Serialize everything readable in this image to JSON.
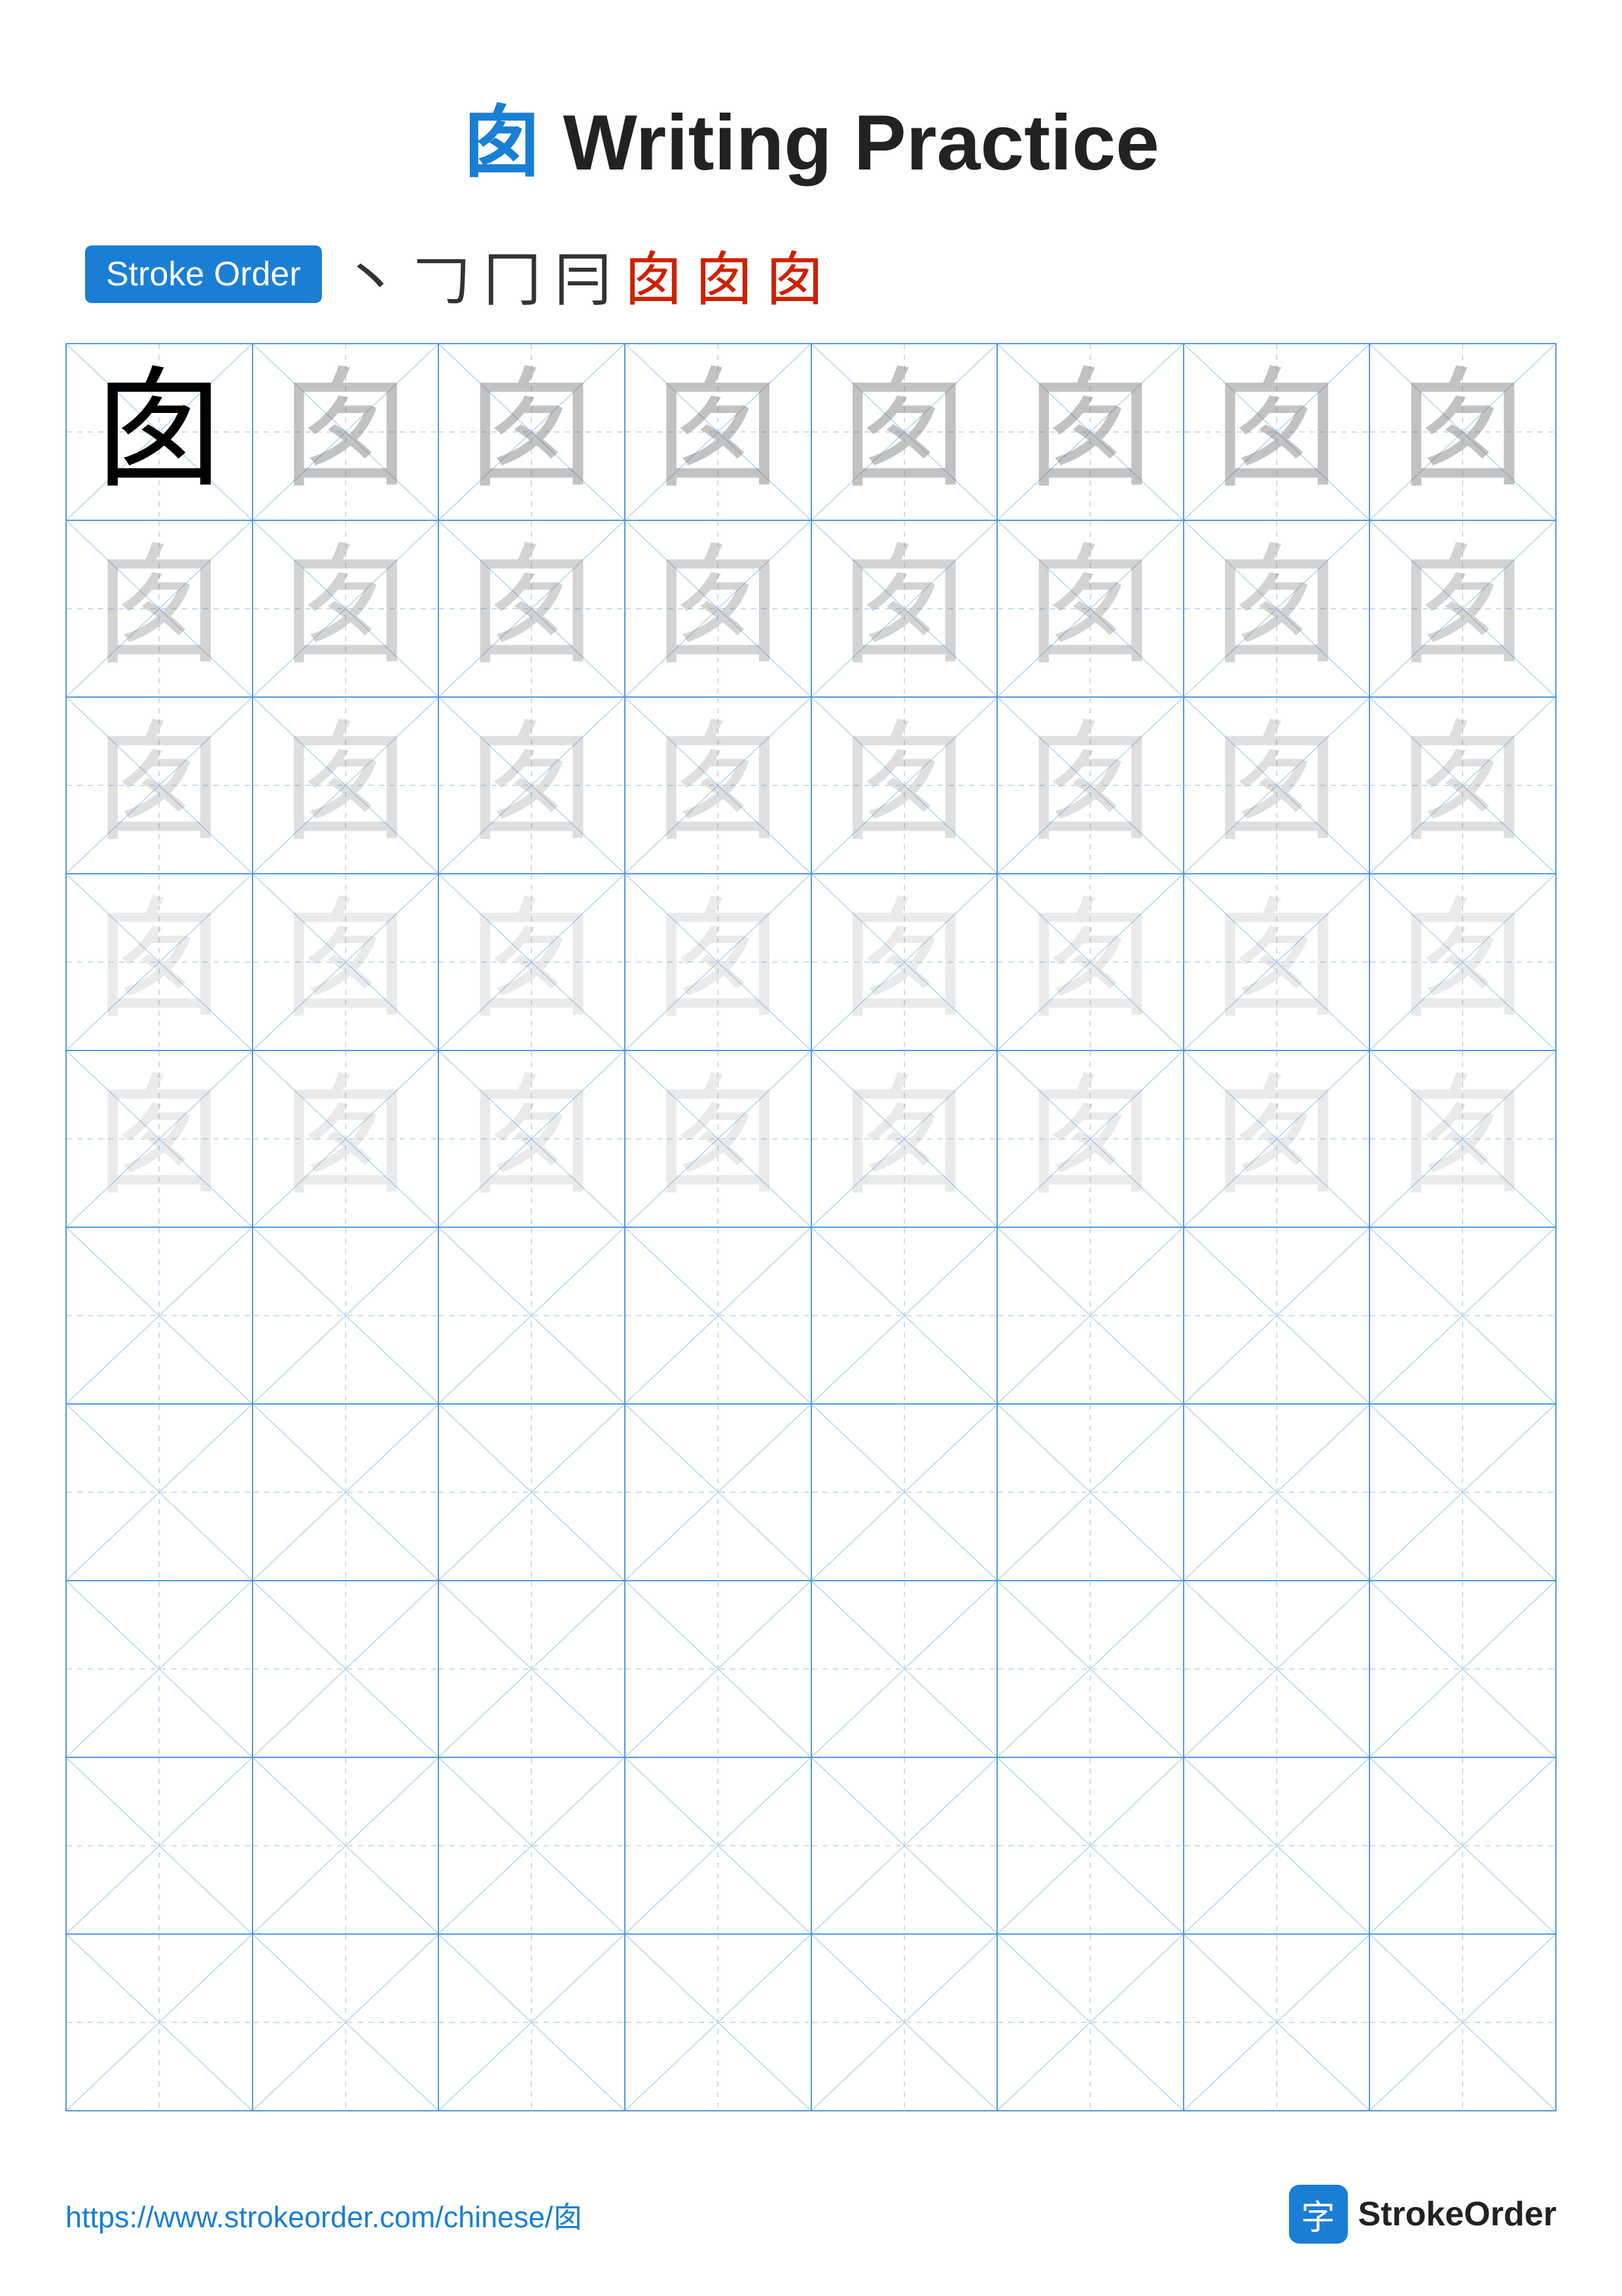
{
  "title": {
    "char": "囱",
    "text": "Writing Practice"
  },
  "stroke_order": {
    "badge_label": "Stroke Order",
    "strokes": [
      "丶",
      "𠃌",
      "冂",
      "冃",
      "囱",
      "囱",
      "囱"
    ]
  },
  "grid": {
    "rows": 10,
    "cols": 8,
    "char": "囱",
    "filled_rows": 5,
    "opacities": [
      1.0,
      0.35,
      0.25,
      0.18,
      0.12
    ]
  },
  "footer": {
    "url": "https://www.strokeorder.com/chinese/囱",
    "logo_char": "字",
    "logo_text": "StrokeOrder"
  }
}
